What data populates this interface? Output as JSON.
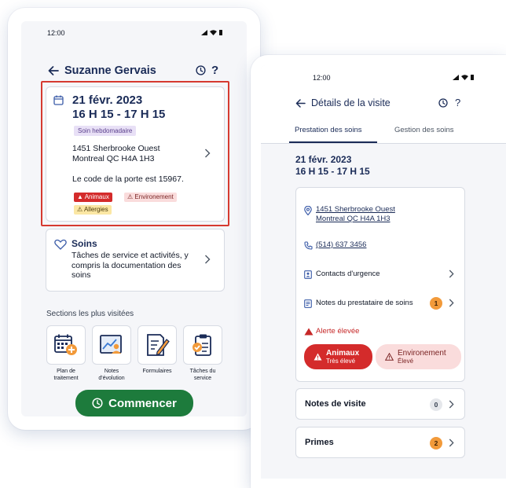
{
  "visit": {
    "status_bar": {
      "time": "12:00"
    },
    "header": {
      "title": "Suzanne Gervais",
      "help": "?"
    },
    "visit_card": {
      "date": "21 févr. 2023",
      "time_range": "16 H 15 - 17 H 15",
      "frequency_tag": "Soin hebdomadaire",
      "address_line1": "1451 Sherbrooke Ouest",
      "address_line2": "Montreal QC H4A 1H3",
      "door_code_note": "Le code de la porte est 15967.",
      "alerts": [
        {
          "label": "Animaux"
        },
        {
          "label": "Environement"
        },
        {
          "label": "Allergies"
        }
      ]
    },
    "soins_card": {
      "title": "Soins",
      "description_lines": [
        "Tâches de service et activités, y",
        "compris la documentation des",
        "soins"
      ]
    },
    "sections": {
      "title": "Sections les plus visitées",
      "items": [
        {
          "label_lines": [
            "Plan de",
            "traitement"
          ],
          "icon": "calendar-plus-icon"
        },
        {
          "label_lines": [
            "Notes",
            "d'évolution"
          ],
          "icon": "chart-person-icon"
        },
        {
          "label_lines": [
            "Formulaires",
            ""
          ],
          "icon": "form-pen-icon"
        },
        {
          "label_lines": [
            "Tâches du",
            "service"
          ],
          "icon": "clipboard-check-icon"
        }
      ]
    },
    "start_button": {
      "label": "Commencer"
    }
  },
  "details": {
    "status_bar": {
      "time": "12:00"
    },
    "header": {
      "title": "Détails de la visite",
      "help": "?"
    },
    "tabs": [
      {
        "label": "Prestation des soins",
        "active": true
      },
      {
        "label": "Gestion des soins",
        "active": false
      }
    ],
    "date": "21 févr. 2023",
    "time_range": "16 H 15 - 17 H 15",
    "info_card": {
      "address_line1": "1451 Sherbrooke Ouest",
      "address_line2": "Montreal QC H4A 1H3",
      "phone": "(514) 637 3456",
      "emergency_contacts": "Contacts d'urgence",
      "provider_notes": "Notes du prestataire de soins",
      "provider_notes_count": "1",
      "alert_title": "Alerte élevée",
      "alert_pills": [
        {
          "label": "Animaux",
          "level": "Très élevé"
        },
        {
          "label": "Environement",
          "level": "Élevé"
        }
      ]
    },
    "visit_notes": {
      "label": "Notes de visite",
      "count": "0"
    },
    "bonuses": {
      "label": "Primes",
      "count": "2"
    }
  },
  "colors": {
    "navy": "#1a2b57",
    "start_green": "#1d7b3c",
    "alert_red": "#d42b2b",
    "warning_pink": "#fadcdc",
    "allergy_yellow": "#fbe7a4",
    "count_orange": "#f29a3a",
    "selection_outline": "#d63a30"
  }
}
